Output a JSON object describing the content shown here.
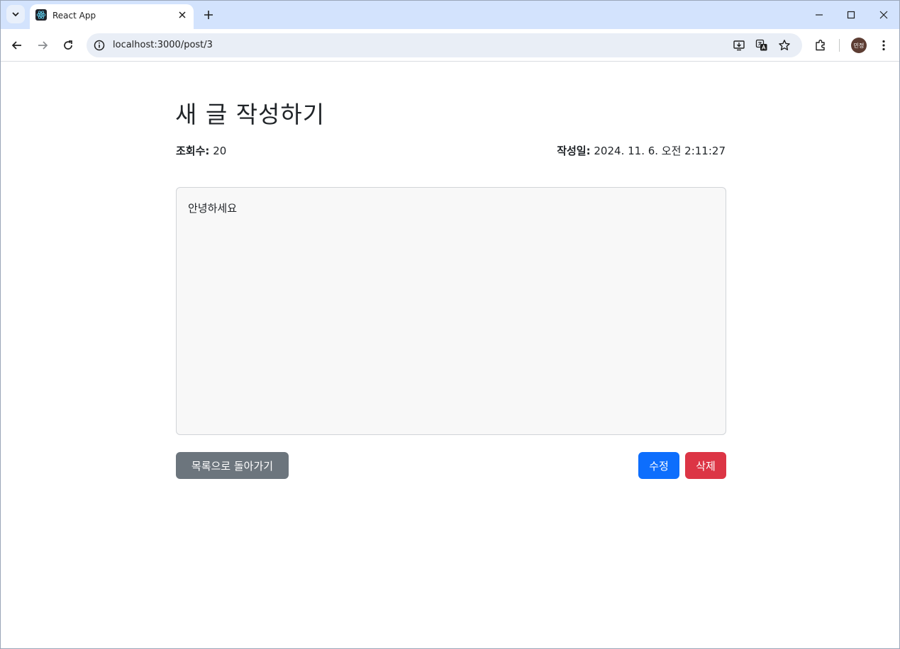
{
  "browser": {
    "tab": {
      "title": "React App"
    },
    "url": "localhost:3000/post/3",
    "profile_initials": "민정"
  },
  "post": {
    "heading": "새 글 작성하기",
    "views_label": "조회수:",
    "views_value": "20",
    "date_label": "작성일:",
    "date_value": "2024. 11. 6. 오전 2:11:27",
    "content": "안녕하세요"
  },
  "actions": {
    "back_label": "목록으로 돌아가기",
    "edit_label": "수정",
    "delete_label": "삭제"
  },
  "colors": {
    "back": "#6c757d",
    "edit": "#0d6efd",
    "delete": "#dc3545",
    "tabstrip": "#d3e3fd"
  }
}
